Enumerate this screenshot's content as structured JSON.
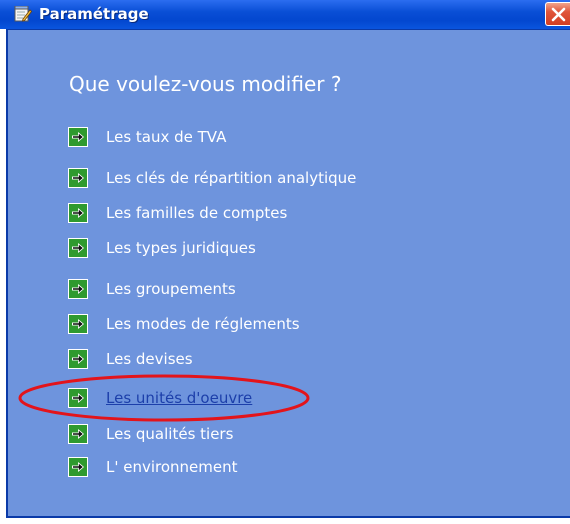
{
  "window": {
    "title": "Paramétrage",
    "icon": "notepad-pencil-icon",
    "close_icon": "close-x-icon"
  },
  "main": {
    "heading": "Que voulez-vous modifier ?",
    "items": [
      {
        "label": "Les taux de TVA",
        "icon": "green-arrow-icon",
        "state": "normal"
      },
      {
        "label": "Les clés de répartition analytique",
        "icon": "green-arrow-icon",
        "state": "normal"
      },
      {
        "label": "Les familles de comptes",
        "icon": "green-arrow-icon",
        "state": "normal"
      },
      {
        "label": "Les types juridiques",
        "icon": "green-arrow-icon",
        "state": "normal"
      },
      {
        "label": "Les groupements",
        "icon": "green-arrow-icon",
        "state": "normal"
      },
      {
        "label": "Les modes de réglements",
        "icon": "green-arrow-icon",
        "state": "normal"
      },
      {
        "label": "Les devises",
        "icon": "green-arrow-icon",
        "state": "normal"
      },
      {
        "label": "Les unités d'oeuvre",
        "icon": "green-arrow-icon",
        "state": "hover-link"
      },
      {
        "label": "Les qualités tiers",
        "icon": "green-arrow-icon",
        "state": "normal"
      },
      {
        "label": "L' environnement",
        "icon": "green-arrow-icon",
        "state": "normal"
      }
    ]
  },
  "annotation": {
    "shape": "red-ellipse",
    "color": "#e3141b"
  },
  "colors": {
    "titlebar": "#0a4fd6",
    "background": "#6e94dd",
    "arrow_box": "#2f9a2f",
    "link": "#1c3faa",
    "close_button": "#d33e22"
  }
}
